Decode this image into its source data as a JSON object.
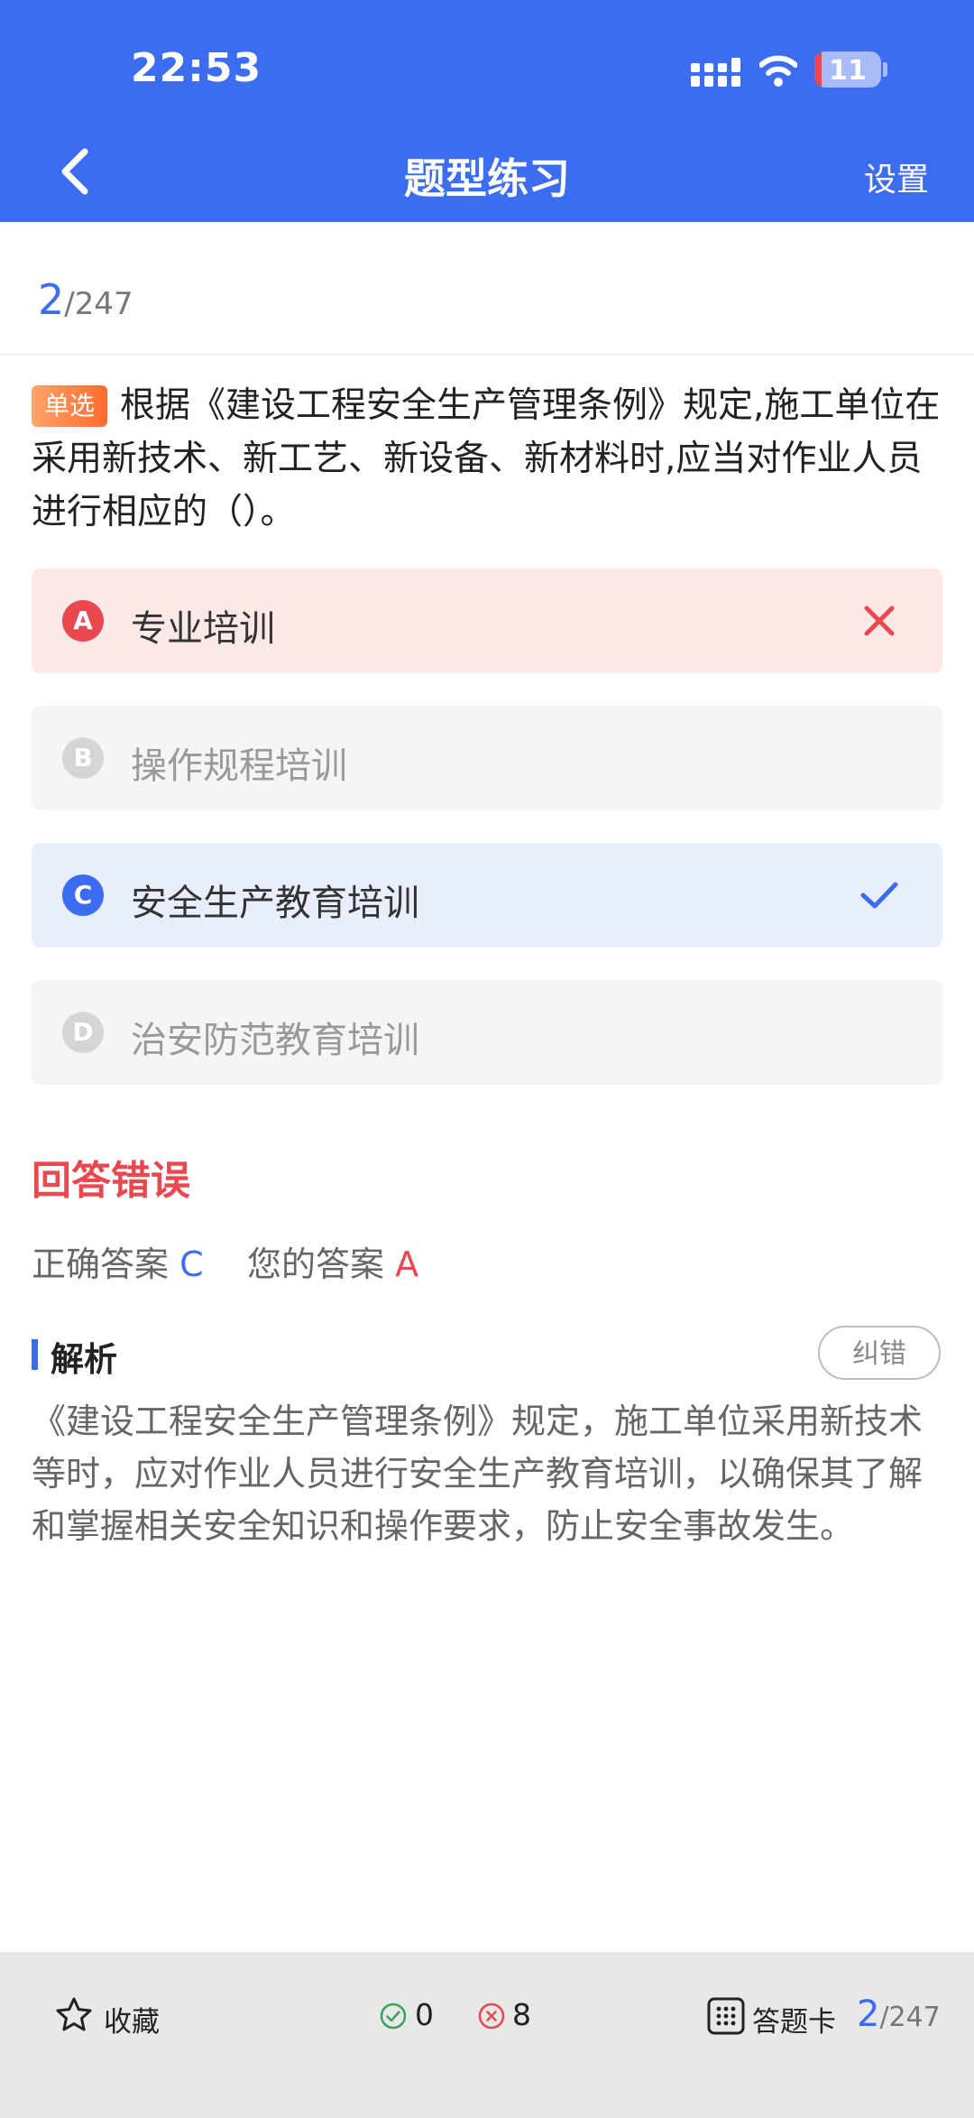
{
  "status_bar": {
    "time": "22:53",
    "battery": "11",
    "battery_level": 0.11
  },
  "header": {
    "title": "题型练习",
    "settings_label": "设置"
  },
  "progress": {
    "current": "2",
    "total": "/247"
  },
  "question": {
    "tag": "单选",
    "text": "根据《建设工程安全生产管理条例》规定,施工单位在采用新技术、新工艺、新设备、新材料时,应当对作业人员进行相应的（）。"
  },
  "options": [
    {
      "letter": "A",
      "text": "专业培训",
      "state": "wrong"
    },
    {
      "letter": "B",
      "text": "操作规程培训",
      "state": "normal"
    },
    {
      "letter": "C",
      "text": "安全生产教育培训",
      "state": "right"
    },
    {
      "letter": "D",
      "text": "治安防范教育培训",
      "state": "normal"
    }
  ],
  "result": {
    "title": "回答错误",
    "correct_label": "正确答案",
    "correct_value": "C",
    "your_label": "您的答案",
    "your_value": "A"
  },
  "analysis": {
    "title": "解析",
    "report_label": "纠错",
    "text": "《建设工程安全生产管理条例》规定，施工单位采用新技术等时，应对作业人员进行安全生产教育培训，以确保其了解和掌握相关安全知识和操作要求，防止安全事故发生。"
  },
  "bottom_bar": {
    "favorite_label": "收藏",
    "correct_count": "0",
    "wrong_count": "8",
    "card_label": "答题卡",
    "progress_current": "2",
    "progress_total": "/247"
  },
  "colors": {
    "primary": "#3c6cf0",
    "error": "#e8484e",
    "tag": "#ff7a3a"
  }
}
